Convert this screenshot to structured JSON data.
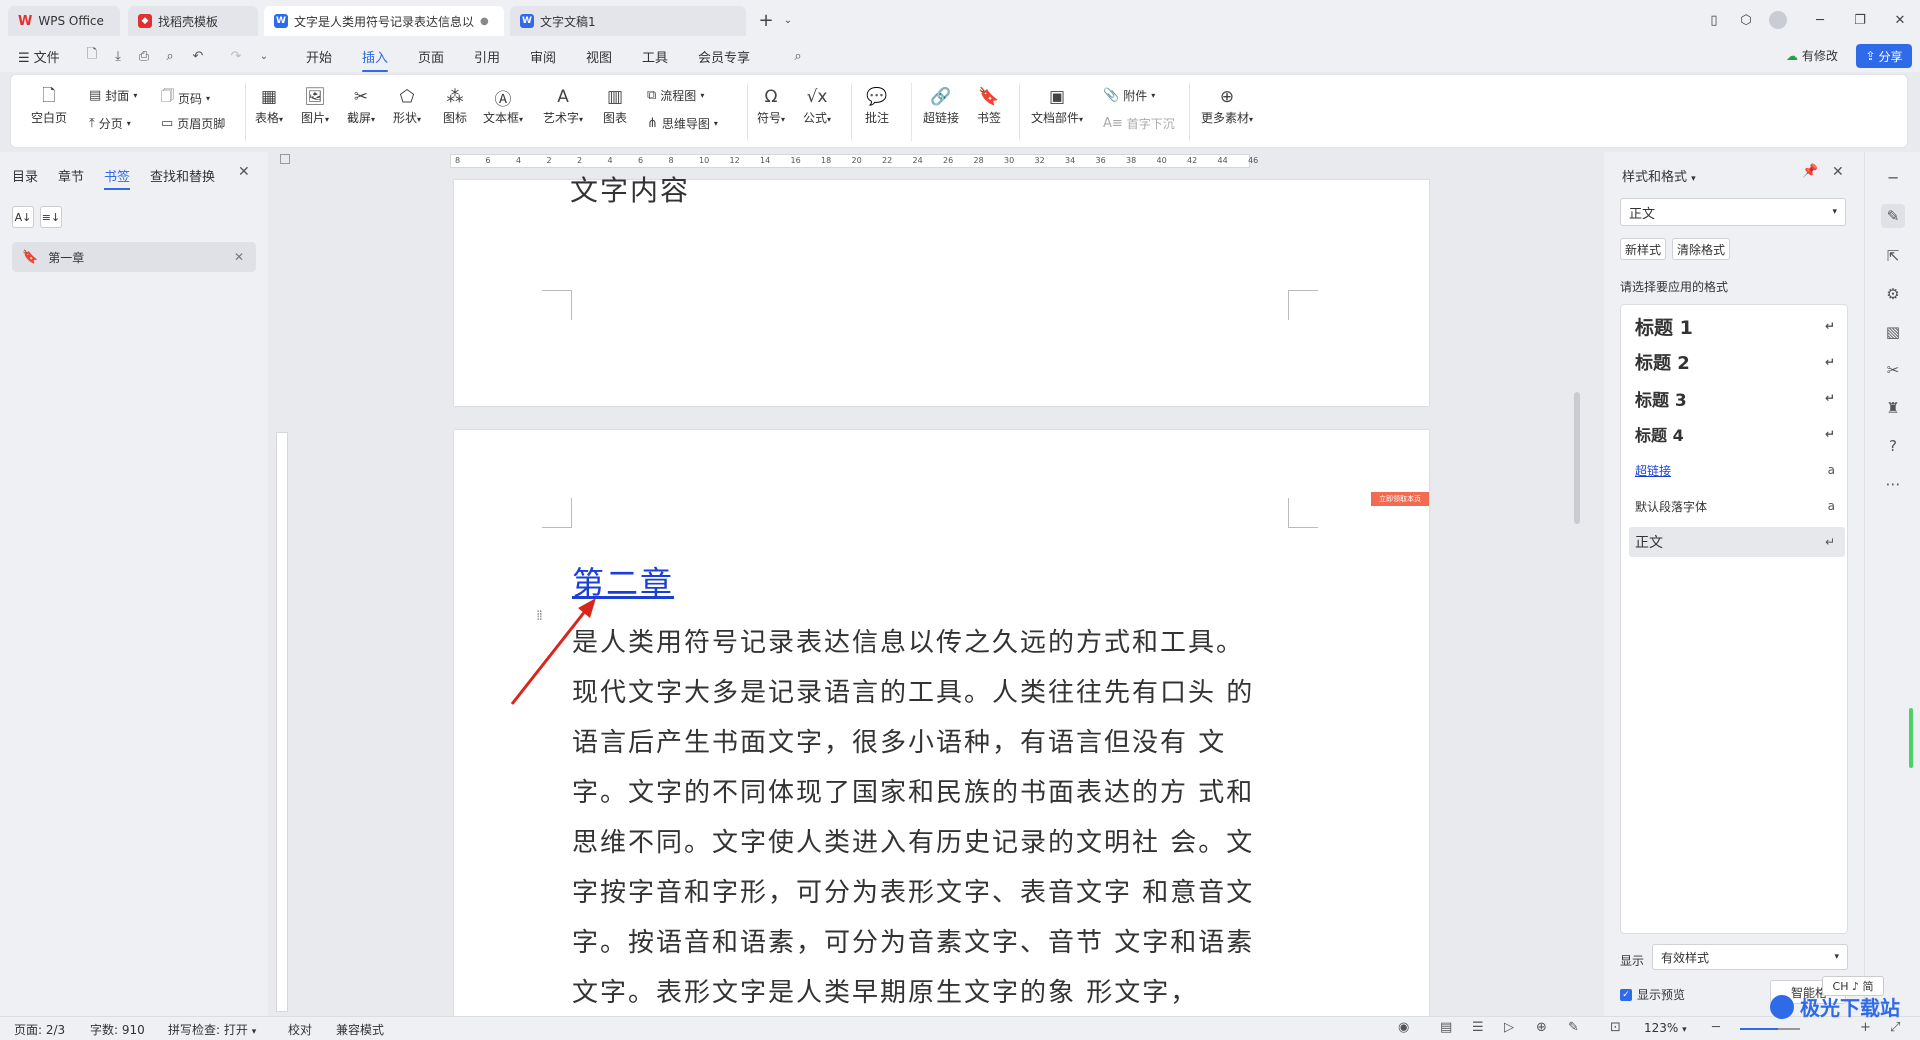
{
  "tabs": [
    {
      "label": "WPS Office"
    },
    {
      "label": "找稻壳模板"
    },
    {
      "label": "文字是人类用符号记录表达信息以"
    },
    {
      "label": "文字文稿1"
    }
  ],
  "menu": {
    "file": "文件",
    "items": [
      "开始",
      "插入",
      "页面",
      "引用",
      "审阅",
      "视图",
      "工具",
      "会员专享"
    ],
    "active": "插入",
    "modified": "有修改",
    "share": "分享"
  },
  "ribbon": {
    "blank_page": "空白页",
    "cover": "封面",
    "page_num": "页码",
    "page_break": "分页",
    "header_footer": "页眉页脚",
    "table": "表格",
    "picture": "图片",
    "screenshot": "截屏",
    "shape": "形状",
    "icon": "图标",
    "textbox": "文本框",
    "wordart": "艺术字",
    "chart": "图表",
    "flowchart": "流程图",
    "mindmap": "思维导图",
    "symbol": "符号",
    "formula": "公式",
    "comment": "批注",
    "hyperlink": "超链接",
    "bookmark": "书签",
    "doc_parts": "文档部件",
    "attachment": "附件",
    "dropcap": "首字下沉",
    "more_material": "更多素材"
  },
  "left_panel": {
    "tabs": [
      "目录",
      "章节",
      "书签",
      "查找和替换"
    ],
    "active_tab": "书签",
    "bookmarks": [
      "第一章"
    ]
  },
  "ruler": {
    "ticks": [
      "8",
      "6",
      "4",
      "2",
      "2",
      "4",
      "6",
      "8",
      "10",
      "12",
      "14",
      "16",
      "18",
      "20",
      "22",
      "24",
      "26",
      "28",
      "30",
      "32",
      "34",
      "36",
      "38",
      "40",
      "42",
      "44",
      "46"
    ]
  },
  "document": {
    "prev_page_text": "文字内容",
    "heading": "第二章",
    "lines": [
      "是人类用符号记录表达信息以传之久远的方式和工具。",
      "现代文字大多是记录语言的工具。人类往往先有口头  的",
      "语言后产生书面文字，很多小语种，有语言但没有  文",
      "字。文字的不同体现了国家和民族的书面表达的方  式和",
      "思维不同。文字使人类进入有历史记录的文明社  会。文",
      "字按字音和字形，可分为表形文字、表音文字  和意音文",
      "字。按语音和语素，可分为音素文字、音节  文字和语素",
      "文字。表形文字是人类早期原生文字的象  形文字，"
    ],
    "tag": "立即领取本页"
  },
  "style_panel": {
    "title": "样式和格式",
    "current_style": "正文",
    "new_style": "新样式",
    "clear_format": "清除格式",
    "prompt": "请选择要应用的格式",
    "styles": [
      {
        "name": "标题 1"
      },
      {
        "name": "标题 2"
      },
      {
        "name": "标题 3"
      },
      {
        "name": "标题 4"
      },
      {
        "name": "超链接"
      },
      {
        "name": "默认段落字体"
      },
      {
        "name": "正文"
      }
    ],
    "show_label": "显示",
    "show_value": "有效样式",
    "preview_label": "显示预览",
    "smart_label": "智能格"
  },
  "status": {
    "page": "页面: 2/3",
    "words": "字数: 910",
    "spellcheck": "拼写检查: 打开",
    "proof": "校对",
    "compat": "兼容模式",
    "zoom": "123%",
    "ime": "CH ♪ 简"
  },
  "watermark": "极光下载站",
  "colors": {
    "accent": "#2f6be8",
    "link": "#1a3fd6",
    "arrow": "#d9261c"
  }
}
